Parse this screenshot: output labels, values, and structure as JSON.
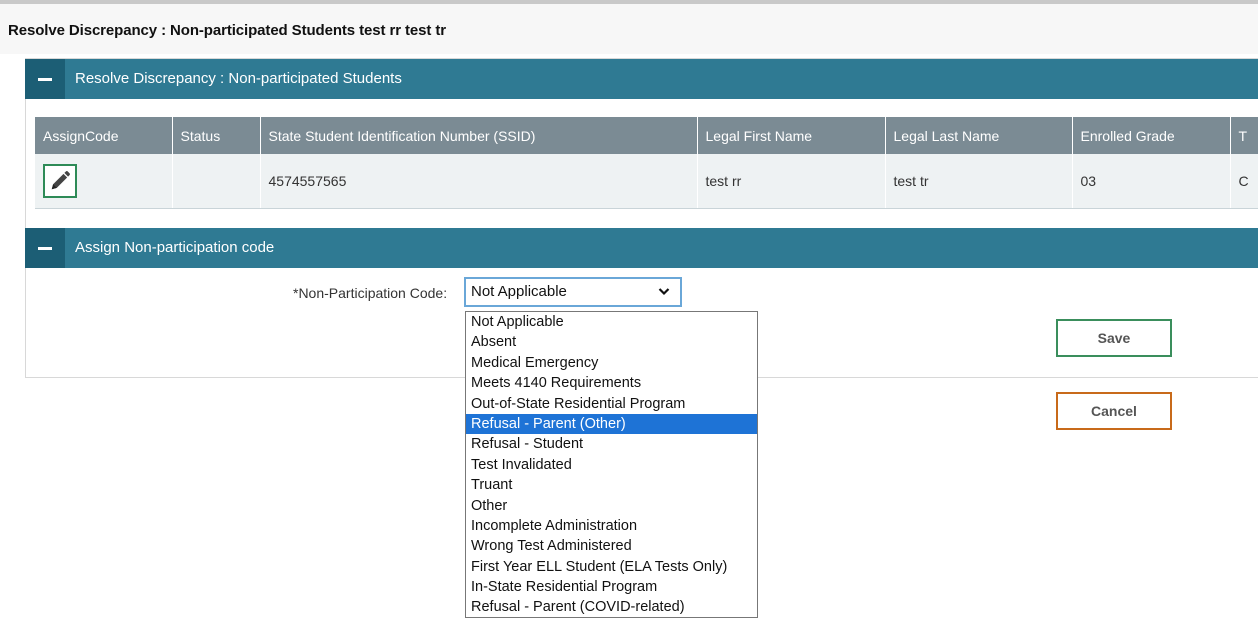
{
  "page": {
    "title": "Resolve Discrepancy : Non-participated Students test rr test tr"
  },
  "students_panel": {
    "header": "Resolve Discrepancy : Non-participated Students",
    "columns": [
      "AssignCode",
      "Status",
      "State Student Identification Number (SSID)",
      "Legal First Name",
      "Legal Last Name",
      "Enrolled Grade",
      "T"
    ],
    "rows": [
      {
        "status": "",
        "ssid": "4574557565",
        "first": "test rr",
        "last": "test tr",
        "grade": "03",
        "extra": "C"
      }
    ],
    "edit_icon": "pencil-icon"
  },
  "assign_panel": {
    "header": "Assign Non-participation code",
    "field_label": "*Non-Participation Code:",
    "selected_value": "Not Applicable",
    "options": [
      "Not Applicable",
      "Absent",
      "Medical Emergency",
      "Meets 4140 Requirements",
      "Out-of-State Residential Program",
      "Refusal - Parent (Other)",
      "Refusal - Student",
      "Test Invalidated",
      "Truant",
      "Other",
      "Incomplete Administration",
      "Wrong Test Administered",
      "First Year ELL Student (ELA Tests Only)",
      "In-State Residential Program",
      "Refusal - Parent (COVID-related)"
    ],
    "highlighted_option": "Refusal - Parent (Other)",
    "save_label": "Save",
    "cancel_label": "Cancel"
  },
  "colors": {
    "header_bar": "#2f7a93",
    "toggle_bar": "#1c5e75",
    "table_header": "#7b8b94",
    "highlight": "#1e73d6",
    "save_border": "#3a8e5c",
    "cancel_border": "#c86a1a"
  }
}
